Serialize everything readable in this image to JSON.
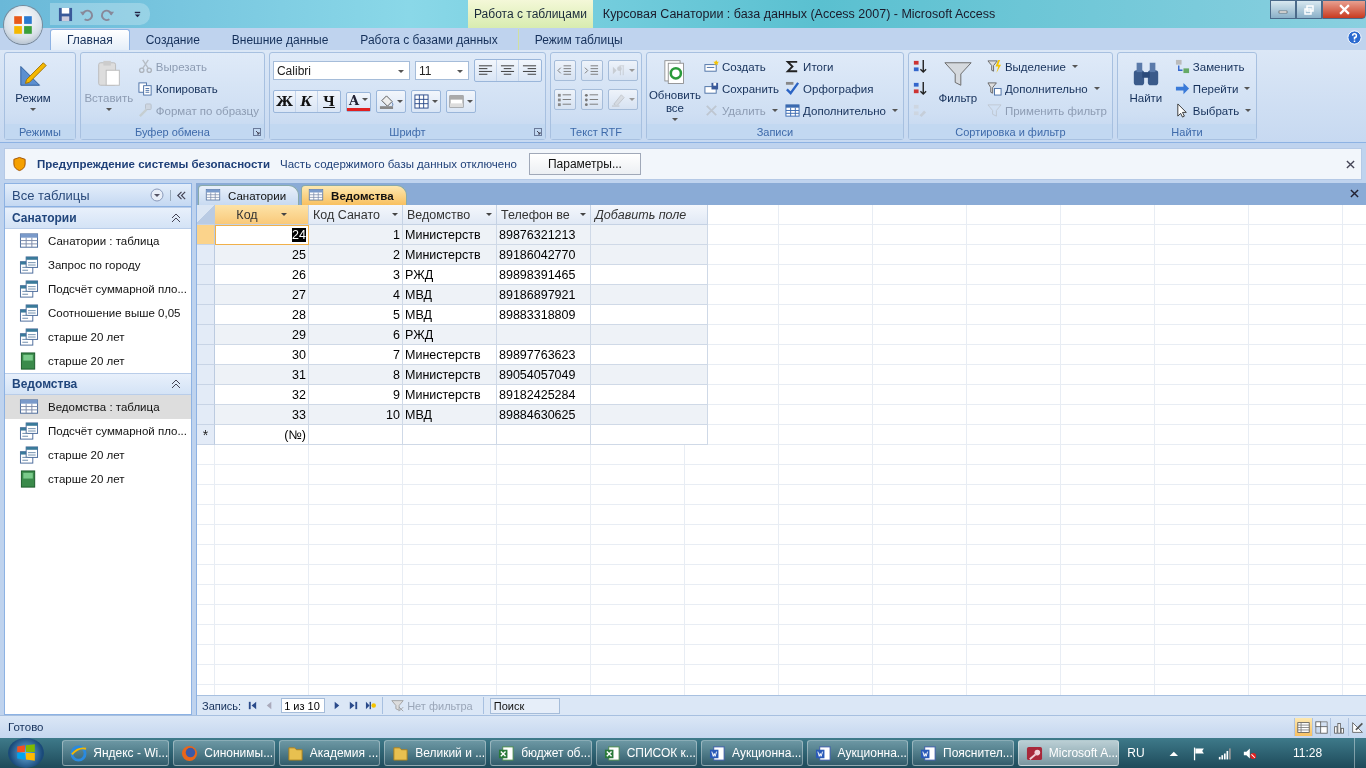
{
  "title_bar": {
    "context_tab": "Работа с таблицами",
    "title": "Курсовая Санатории : база данных (Access 2007)  -  Microsoft Access"
  },
  "ribbon_tabs": [
    {
      "label": "Главная",
      "selected": true
    },
    {
      "label": "Создание",
      "selected": false
    },
    {
      "label": "Внешние данные",
      "selected": false
    },
    {
      "label": "Работа с базами данных",
      "selected": false
    },
    {
      "label": "Режим таблицы",
      "selected": false
    }
  ],
  "ribbon_groups": [
    {
      "label": "Режимы",
      "launcher": false,
      "items": [
        {
          "kind": "large",
          "label": "Режим",
          "disabled": false,
          "dropdown": true
        }
      ]
    },
    {
      "label": "Буфер обмена",
      "launcher": true,
      "items": [
        {
          "kind": "large",
          "label": "Вставить",
          "disabled": true,
          "dropdown": true
        },
        {
          "kind": "stack",
          "buttons": [
            {
              "label": "Вырезать",
              "disabled": true,
              "dropdown": false
            },
            {
              "label": "Копировать",
              "disabled": false,
              "dropdown": false
            },
            {
              "label": "Формат по образцу",
              "disabled": true,
              "dropdown": false
            }
          ]
        }
      ]
    },
    {
      "label": "Шрифт",
      "launcher": true,
      "items": [
        {
          "kind": "font",
          "font": "Calibri",
          "size": "11",
          "format_buttons": [
            "Ж",
            "К",
            "Ч"
          ],
          "color_letter": "A"
        }
      ]
    },
    {
      "label": "Текст RTF",
      "launcher": false,
      "items": [
        {
          "kind": "icon_grid",
          "buttons": [
            {
              "disabled": false,
              "dropdown": false
            },
            {
              "disabled": false,
              "dropdown": false
            },
            {
              "disabled": true,
              "dropdown": true
            },
            {
              "disabled": false,
              "dropdown": false
            },
            {
              "disabled": false,
              "dropdown": false
            },
            {
              "disabled": true,
              "dropdown": true
            }
          ]
        }
      ]
    },
    {
      "label": "Записи",
      "launcher": false,
      "items": [
        {
          "kind": "large",
          "label": "Обновить все",
          "disabled": false,
          "dropdown": true
        },
        {
          "kind": "stack",
          "buttons": [
            {
              "label": "Создать",
              "disabled": false,
              "dropdown": false
            },
            {
              "label": "Сохранить",
              "disabled": false,
              "dropdown": false
            },
            {
              "label": "Удалить",
              "disabled": true,
              "dropdown": true
            }
          ]
        },
        {
          "kind": "stack",
          "buttons": [
            {
              "label": "Итоги",
              "disabled": false,
              "dropdown": false
            },
            {
              "label": "Орфография",
              "disabled": false,
              "dropdown": false
            },
            {
              "label": "Дополнительно",
              "disabled": false,
              "dropdown": true
            }
          ]
        }
      ]
    },
    {
      "label": "Сортировка и фильтр",
      "launcher": false,
      "items": [
        {
          "kind": "stack",
          "buttons": [
            {
              "disabled": false,
              "dropdown": false
            },
            {
              "disabled": false,
              "dropdown": false
            },
            {
              "disabled": true,
              "dropdown": false
            }
          ]
        },
        {
          "kind": "large",
          "label": "Фильтр",
          "disabled": false,
          "dropdown": false
        },
        {
          "kind": "stack",
          "buttons": [
            {
              "label": "Выделение",
              "disabled": false,
              "dropdown": true
            },
            {
              "label": "Дополнительно",
              "disabled": false,
              "dropdown": true
            },
            {
              "label": "Применить фильтр",
              "disabled": true,
              "dropdown": false
            }
          ]
        }
      ]
    },
    {
      "label": "Найти",
      "launcher": false,
      "items": [
        {
          "kind": "large",
          "label": "Найти",
          "disabled": false,
          "dropdown": false
        },
        {
          "kind": "stack",
          "buttons": [
            {
              "label": "Заменить",
              "disabled": false,
              "dropdown": false
            },
            {
              "label": "Перейти",
              "disabled": false,
              "dropdown": true
            },
            {
              "label": "Выбрать",
              "disabled": false,
              "dropdown": true
            }
          ]
        }
      ]
    }
  ],
  "security_bar": {
    "title": "Предупреждение системы безопасности",
    "message": "Часть содержимого базы данных отключено",
    "button": "Параметры..."
  },
  "nav_pane": {
    "title": "Все таблицы",
    "groups": [
      {
        "label": "Санатории",
        "expanded": true,
        "items": [
          {
            "kind": "table",
            "label": "Санатории : таблица",
            "selected": false
          },
          {
            "kind": "query",
            "label": "Запрос по городу",
            "selected": false
          },
          {
            "kind": "query",
            "label": "Подсчёт суммарной пло...",
            "selected": false
          },
          {
            "kind": "query",
            "label": "Соотношение выше 0,05",
            "selected": false
          },
          {
            "kind": "query",
            "label": "старше 20 лет",
            "selected": false
          },
          {
            "kind": "form",
            "label": "старше 20 лет",
            "selected": false
          }
        ]
      },
      {
        "label": "Ведомства",
        "expanded": true,
        "items": [
          {
            "kind": "table",
            "label": "Ведомства : таблица",
            "selected": true
          },
          {
            "kind": "query",
            "label": "Подсчёт суммарной пло...",
            "selected": false
          },
          {
            "kind": "query",
            "label": "старше 20 лет",
            "selected": false
          },
          {
            "kind": "form",
            "label": "старше 20 лет",
            "selected": false
          }
        ]
      }
    ]
  },
  "document_tabs": [
    {
      "label": "Санатории",
      "selected": false
    },
    {
      "label": "Ведомства",
      "selected": true
    }
  ],
  "table": {
    "columns": [
      {
        "label": "Код",
        "kind": "number"
      },
      {
        "label": "Код Санато",
        "kind": "number"
      },
      {
        "label": "Ведомство",
        "kind": "text"
      },
      {
        "label": "Телефон ве",
        "kind": "text"
      },
      {
        "label": "Добавить поле",
        "kind": "add"
      }
    ],
    "rows": [
      {
        "selected": true,
        "cells": [
          "24",
          "1",
          "Министерств",
          "89876321213"
        ]
      },
      {
        "selected": false,
        "cells": [
          "25",
          "2",
          "Министерств",
          "89186042770"
        ]
      },
      {
        "selected": false,
        "cells": [
          "26",
          "3",
          "РЖД",
          "89898391465"
        ]
      },
      {
        "selected": false,
        "cells": [
          "27",
          "4",
          "МВД",
          "89186897921"
        ]
      },
      {
        "selected": false,
        "cells": [
          "28",
          "5",
          "МВД",
          "89883318809"
        ]
      },
      {
        "selected": false,
        "cells": [
          "29",
          "6",
          "РЖД",
          null
        ]
      },
      {
        "selected": false,
        "cells": [
          "30",
          "7",
          "Минестерств",
          "89897763623"
        ]
      },
      {
        "selected": false,
        "cells": [
          "31",
          "8",
          "Министерств",
          "89054057049"
        ]
      },
      {
        "selected": false,
        "cells": [
          "32",
          "9",
          "Министерств",
          "89182425284"
        ]
      },
      {
        "selected": false,
        "cells": [
          "33",
          "10",
          "МВД",
          "89884630625"
        ]
      }
    ],
    "new_row": {
      "marker": "*",
      "placeholder": "(№)"
    }
  },
  "record_bar": {
    "label": "Запись:",
    "position": "1 из 10",
    "filter": "Нет фильтра",
    "filter_disabled": true,
    "search": {
      "placeholder": "Поиск"
    }
  },
  "status_bar": {
    "text": "Готово",
    "view_buttons": [
      {
        "selected": true
      },
      {
        "selected": false
      },
      {
        "selected": false
      },
      {
        "selected": false
      }
    ]
  },
  "taskbar": {
    "items": [
      {
        "kind": "browser",
        "label": "Яндекс - Wi...",
        "selected": false
      },
      {
        "kind": "firefox",
        "label": "Синонимы...",
        "selected": false
      },
      {
        "kind": "folder",
        "label": "Академия ...",
        "selected": false
      },
      {
        "kind": "folder",
        "label": "Великий и ...",
        "selected": false
      },
      {
        "kind": "excel",
        "label": "бюджет об...",
        "selected": false
      },
      {
        "kind": "excel",
        "label": "СПИСОК к...",
        "selected": false
      },
      {
        "kind": "word",
        "label": "Аукционна...",
        "selected": false
      },
      {
        "kind": "word",
        "label": "Аукционна...",
        "selected": false
      },
      {
        "kind": "word",
        "label": "Пояснител...",
        "selected": false
      },
      {
        "kind": "access",
        "label": "Microsoft A...",
        "selected": true
      }
    ],
    "language": "RU",
    "clock": "11:28"
  }
}
